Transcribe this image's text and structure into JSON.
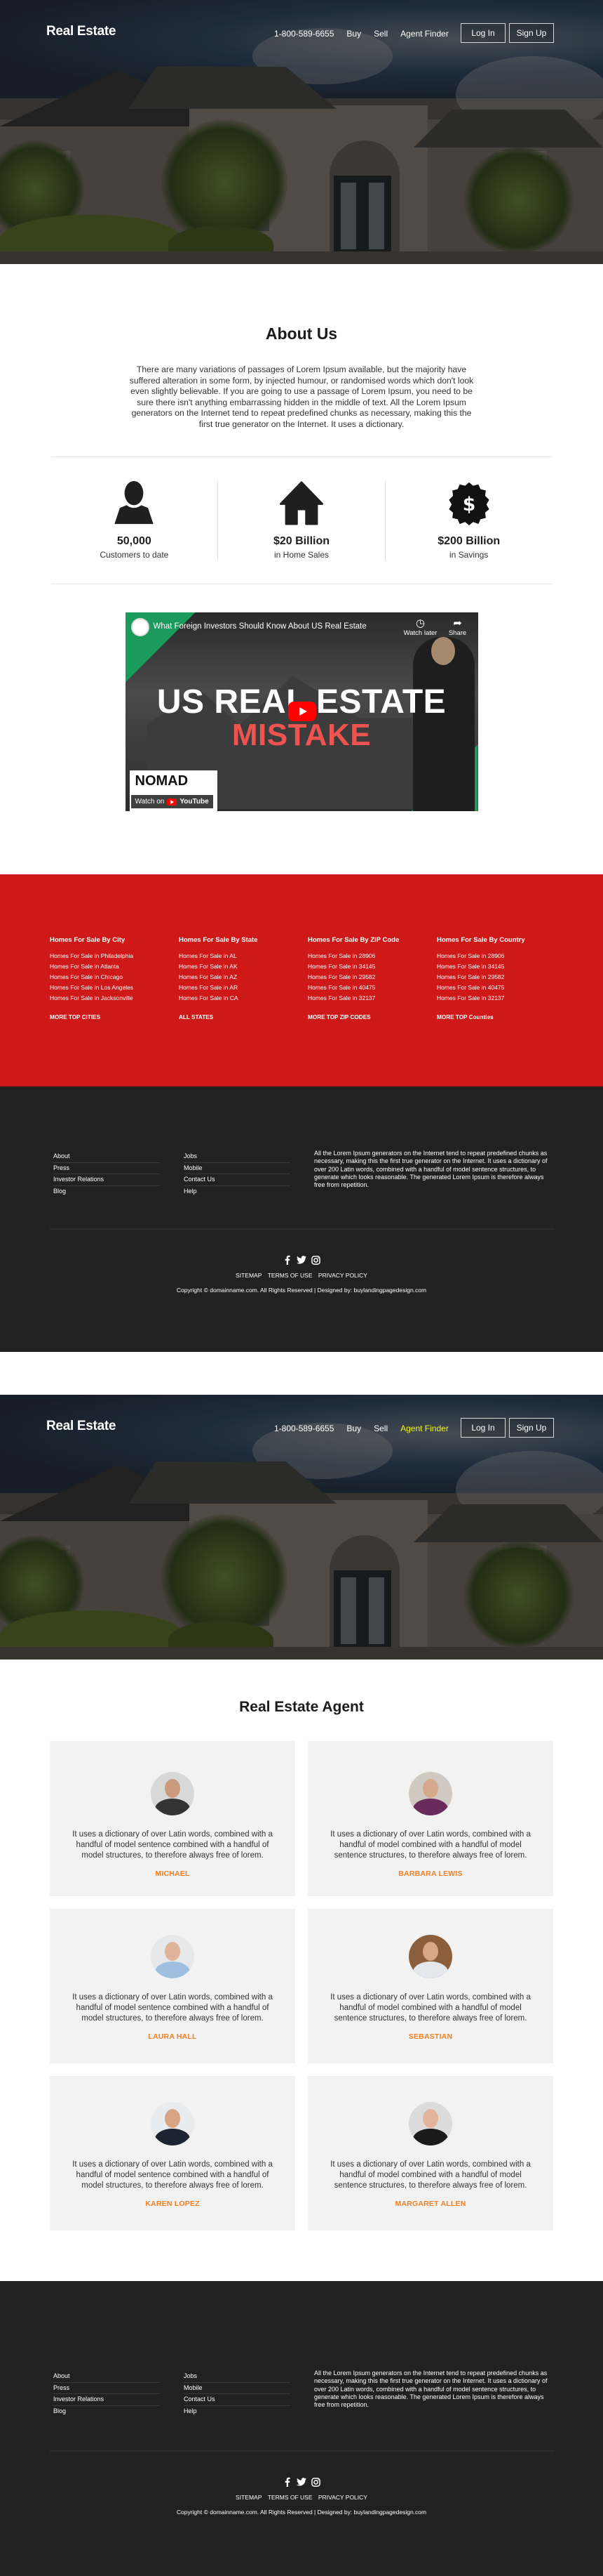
{
  "header": {
    "brand": "Real Estate",
    "phone": "1-800-589-6655",
    "links": [
      "Buy",
      "Sell",
      "Agent Finder"
    ],
    "login": "Log In",
    "signup": "Sign Up",
    "active_link_color": "#f1f514"
  },
  "about": {
    "title": "About Us",
    "text": "There are many variations of passages of Lorem Ipsum available, but the majority have suffered alteration in some form, by injected humour, or randomised words which don't look even slightly believable. If you are going to use a passage of Lorem Ipsum, you need to be sure there isn't anything embarrassing hidden in the middle of text. All the Lorem Ipsum generators on the Internet tend to repeat predefined chunks as necessary, making this the first true generator on the Internet. It uses a dictionary."
  },
  "stats": [
    {
      "icon": "user-icon",
      "value": "50,000",
      "label": "Customers to date"
    },
    {
      "icon": "house-icon",
      "value": "$20 Billion",
      "label": "in Home Sales"
    },
    {
      "icon": "dollar-badge-icon",
      "value": "$200 Billion",
      "label": "in Savings"
    }
  ],
  "video": {
    "title": "What Foreign Investors Should Know About US Real Estate",
    "watch_later": "Watch later",
    "share": "Share",
    "headline_1": "US REAL ESTATE",
    "headline_2": "MISTAKE",
    "channel_logo": "NOMAD",
    "watch_on": "Watch on",
    "youtube": "YouTube"
  },
  "listings": {
    "background": "#cf1818",
    "columns": [
      {
        "title": "Homes For Sale By City",
        "links": [
          "Homes For Sale in Philadelphia",
          "Homes For Sale in Atlanta",
          "Homes For Sale in Chicago",
          "Homes For Sale in Los Angeles",
          "Homes For Sale in Jacksonville"
        ],
        "more": "MORE TOP CITIES"
      },
      {
        "title": "Homes For Sale By State",
        "links": [
          "Homes For Sale in AL",
          "Homes For Sale in AK",
          "Homes For Sale in AZ",
          "Homes For Sale in AR",
          "Homes For Sale in CA"
        ],
        "more": "ALL STATES"
      },
      {
        "title": "Homes For Sale By ZIP Code",
        "links": [
          "Homes For Sale in 28906",
          "Homes For Sale in 34145",
          "Homes For Sale in 29582",
          "Homes For Sale in 40475",
          "Homes For Sale in 32137"
        ],
        "more": "MORE TOP ZIP CODES"
      },
      {
        "title": "Homes For Sale By Country",
        "links": [
          "Homes For Sale in 28906",
          "Homes For Sale in 34145",
          "Homes For Sale in 29582",
          "Homes For Sale in 40475",
          "Homes For Sale in 32137"
        ],
        "more": "MORE TOP Counties"
      }
    ]
  },
  "footer": {
    "col1": [
      "About",
      "Press",
      "Investor Relations",
      "Blog"
    ],
    "col2": [
      "Jobs",
      "Mobile",
      "Contact Us",
      "Help"
    ],
    "text": "All the Lorem Ipsum generators on the Internet tend to repeat predefined chunks as necessary, making this the first true generator on the Internet. It uses a dictionary of over 200 Latin words, combined with a handful of model sentence structures, to generate which looks reasonable. The generated Lorem Ipsum is therefore always free from repetition.",
    "social": [
      "facebook-icon",
      "twitter-icon",
      "instagram-icon"
    ],
    "legal": [
      "SITEMAP",
      "TERMS OF USE",
      "PRIVACY POLICY"
    ],
    "copyright": "Copyright © domainname.com. All Rights Reserved | Designed by: buylandingpagedesign.com"
  },
  "agents": {
    "title": "Real Estate Agent",
    "name_color": "#f57f22",
    "items": [
      {
        "name": "MICHAEL",
        "text": "It uses a dictionary of over Latin words, combined with a handful of model sentence combined with a handful of model structures, to therefore always free of lorem."
      },
      {
        "name": "BARBARA LEWIS",
        "text": "It uses a dictionary of over Latin words, combined with a handful of model combined with a handful of model sentence structures, to therefore always free of lorem."
      },
      {
        "name": "LAURA HALL",
        "text": "It uses a dictionary of over Latin words, combined with a handful of model sentence combined with a handful of model structures, to therefore always free of lorem."
      },
      {
        "name": "SEBASTIAN",
        "text": "It uses a dictionary of over Latin words, combined with a handful of model combined with a handful of model sentence structures, to therefore always free of lorem."
      },
      {
        "name": "KAREN LOPEZ",
        "text": "It uses a dictionary of over Latin words, combined with a handful of model sentence combined with a handful of model structures, to therefore always free of lorem."
      },
      {
        "name": "MARGARET ALLEN",
        "text": "It uses a dictionary of over Latin words, combined with a handful of model combined with a handful of model sentence structures, to therefore always free of lorem."
      }
    ]
  }
}
